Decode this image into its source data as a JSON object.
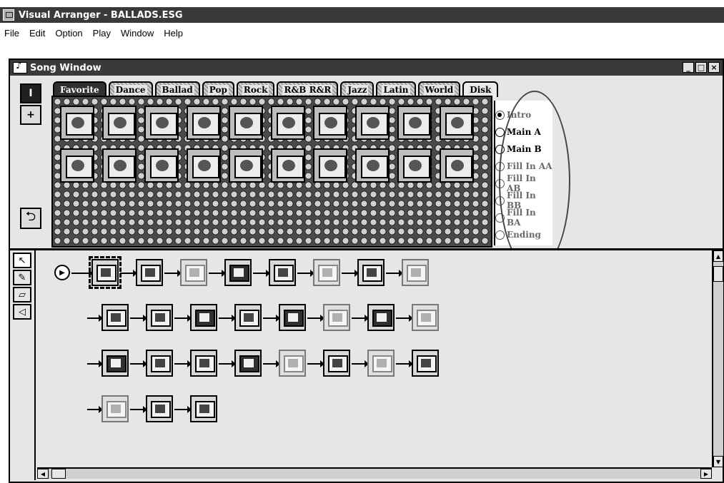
{
  "app": {
    "title": "Visual Arranger - BALLADS.ESG"
  },
  "menu": [
    "File",
    "Edit",
    "Option",
    "Play",
    "Window",
    "Help"
  ],
  "song_window": {
    "title": "Song Window",
    "controls": {
      "minimize": "_",
      "maximize": "□",
      "close": "×"
    }
  },
  "tabs": [
    "Favorite",
    "Dance",
    "Ballad",
    "Pop",
    "Rock",
    "R&B R&R",
    "Jazz",
    "Latin",
    "World",
    "Disk"
  ],
  "active_tab": "Favorite",
  "sections": [
    {
      "label": "Intro",
      "selected": true,
      "enabled": false
    },
    {
      "label": "Main A",
      "selected": false,
      "enabled": true
    },
    {
      "label": "Main B",
      "selected": false,
      "enabled": true
    },
    {
      "label": "Fill In AA",
      "selected": false,
      "enabled": false
    },
    {
      "label": "Fill In AB",
      "selected": false,
      "enabled": false
    },
    {
      "label": "Fill In BB",
      "selected": false,
      "enabled": false
    },
    {
      "label": "Fill In BA",
      "selected": false,
      "enabled": false
    },
    {
      "label": "Ending",
      "selected": false,
      "enabled": false
    }
  ],
  "left_tools": [
    {
      "name": "tempo-tool-icon",
      "glyph": "I"
    },
    {
      "name": "position-tool-icon",
      "glyph": "+"
    }
  ],
  "edit_tools": [
    {
      "name": "pointer-tool-icon",
      "glyph": "↖"
    },
    {
      "name": "pencil-tool-icon",
      "glyph": "✎"
    },
    {
      "name": "eraser-tool-icon",
      "glyph": "▱"
    },
    {
      "name": "speaker-tool-icon",
      "glyph": "◁"
    }
  ],
  "icon_glyphs": {
    "play": "▶",
    "return": "⮌",
    "scroll_up": "▲",
    "scroll_down": "▼",
    "scroll_left": "◀",
    "scroll_right": "▶"
  }
}
